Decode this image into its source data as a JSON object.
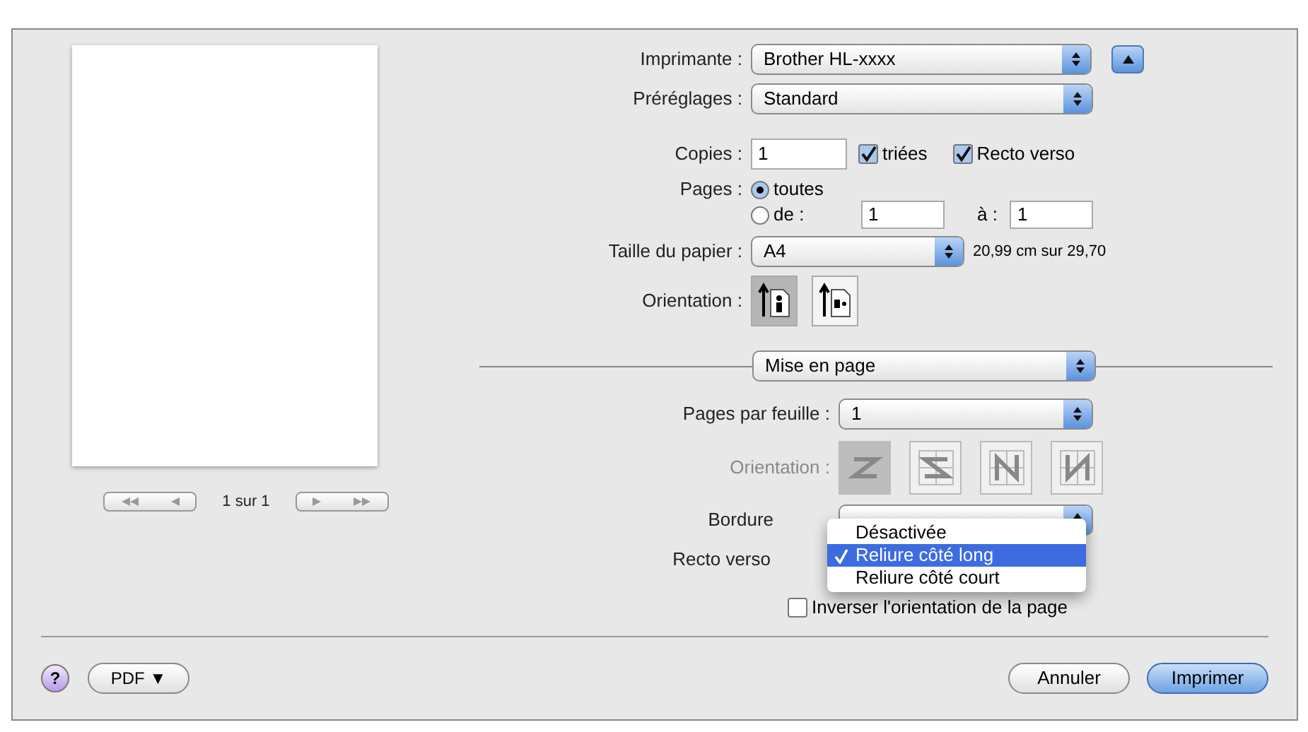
{
  "preview": {
    "page_label": "1 sur 1"
  },
  "printer": {
    "label": "Imprimante :",
    "value": "Brother HL-xxxx"
  },
  "presets": {
    "label": "Préréglages :",
    "value": "Standard"
  },
  "copies": {
    "label": "Copies :",
    "value": "1",
    "collated": {
      "label": "triées",
      "checked": true
    },
    "duplex": {
      "label": "Recto verso",
      "checked": true
    }
  },
  "pages": {
    "label": "Pages :",
    "options": [
      {
        "label": "toutes",
        "selected": true
      },
      {
        "label": "de :",
        "selected": false
      }
    ],
    "from": "1",
    "to_label": "à :",
    "to": "1"
  },
  "paper": {
    "label": "Taille du papier :",
    "value": "A4",
    "size": "20,99 cm sur 29,70"
  },
  "orientation": {
    "label": "Orientation :",
    "options": [
      {
        "kind": "portrait",
        "selected": true
      },
      {
        "kind": "landscape",
        "selected": false
      }
    ]
  },
  "section": {
    "value": "Mise en page"
  },
  "layout": {
    "pages_per_sheet": {
      "label": "Pages par feuille :",
      "value": "1"
    },
    "direction": {
      "label": "Orientation :",
      "disabled": true,
      "options": [
        {
          "kind": "z",
          "selected": true
        },
        {
          "kind": "s",
          "selected": false
        },
        {
          "kind": "n-reverse",
          "selected": false
        },
        {
          "kind": "n",
          "selected": false
        }
      ]
    },
    "border": {
      "label": "Bordure"
    },
    "duplex": {
      "label": "Recto verso"
    },
    "reverse": {
      "label": "Inverser l'orientation de la page",
      "checked": false
    }
  },
  "menu": [
    {
      "label": "Désactivée",
      "selected": false
    },
    {
      "label": "Reliure côté long",
      "selected": true
    },
    {
      "label": "Reliure côté court",
      "selected": false
    }
  ],
  "footer": {
    "help": "?",
    "pdf": "PDF ▼",
    "cancel": "Annuler",
    "print": "Imprimer"
  }
}
